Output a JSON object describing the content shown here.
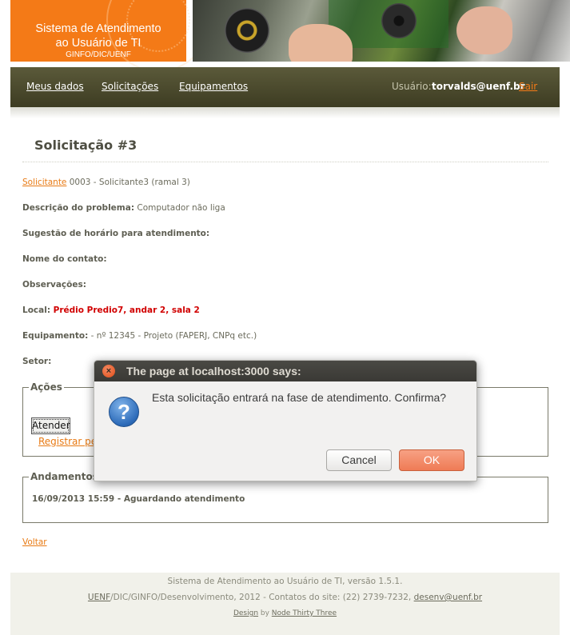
{
  "header": {
    "brand_line1": "Sistema de Atendimento",
    "brand_line2": "ao Usuário de TI",
    "brand_line3": "GINFO/DIC/UENF"
  },
  "nav": {
    "items": [
      {
        "label": "Meus dados"
      },
      {
        "label": "Solicitações"
      },
      {
        "label": "Equipamentos"
      }
    ],
    "user_label": "Usuário:",
    "user_value": "torvalds@uenf.br",
    "logout": "Sair"
  },
  "page": {
    "title": "Solicitação #3"
  },
  "fields": {
    "solicitante_label": "Solicitante",
    "solicitante_value": " 0003 - Solicitante3 (ramal 3)",
    "descricao_label": "Descrição do problema:",
    "descricao_value": " Computador não liga",
    "sugestao_label": "Sugestão de horário para atendimento:",
    "contato_label": "Nome do contato:",
    "observacoes_label": "Observações:",
    "local_label": "Local:",
    "local_value": " Prédio Predio7, andar 2, sala 2",
    "equipamento_label": "Equipamento:",
    "equipamento_value": " - nº 12345 - Projeto (FAPERJ, CNPq etc.)",
    "setor_label": "Setor:"
  },
  "acoes": {
    "legend": "Ações",
    "atender_button": "Atender",
    "registrar_link": "Registrar pe"
  },
  "andamentos": {
    "legend": "Andamentos",
    "items": [
      {
        "text": "16/09/2013 15:59 - Aguardando atendimento"
      }
    ]
  },
  "voltar": "Voltar",
  "footer": {
    "line1": "Sistema de Atendimento ao Usuário de TI, versão 1.5.1.",
    "uenf_link": "UENF",
    "line2_middle": "/DIC/GINFO/Desenvolvimento, 2012 - Contatos do site: (22) 2739-7232, ",
    "email_link": "desenv@uenf.br",
    "design_link": "Design",
    "by": " by ",
    "node_link": "Node Thirty Three"
  },
  "dialog": {
    "title": "The page at localhost:3000 says:",
    "message": "Esta solicitação entrará na fase de atendimento. Confirma?",
    "cancel_label": "Cancel",
    "ok_label": "OK",
    "icon": "question-icon",
    "ok_color": "#ef7b55"
  }
}
